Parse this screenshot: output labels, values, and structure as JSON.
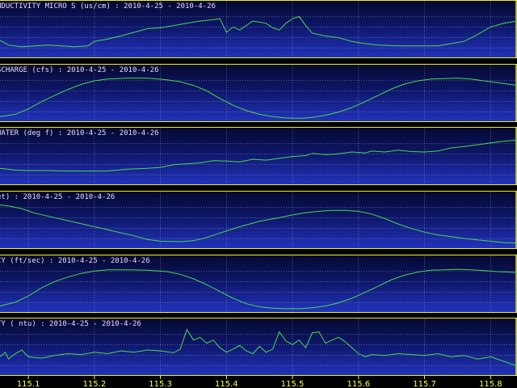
{
  "chart_data": {
    "type": "line",
    "x_ticks": [
      "115.1",
      "115.2",
      "115.3",
      "115.4",
      "115.5",
      "115.6",
      "115.7",
      "115.8"
    ],
    "xlim": [
      115.057,
      115.84
    ],
    "panels": [
      {
        "title": "NDUCTIVITY MICRO S (us/cm) : 2010-4-25 - 2010-4-26",
        "series_color": "#4cd84c",
        "points": [
          [
            115.057,
            0.32
          ],
          [
            115.07,
            0.22
          ],
          [
            115.09,
            0.18
          ],
          [
            115.11,
            0.2
          ],
          [
            115.13,
            0.22
          ],
          [
            115.15,
            0.2
          ],
          [
            115.17,
            0.18
          ],
          [
            115.19,
            0.2
          ],
          [
            115.2,
            0.3
          ],
          [
            115.22,
            0.35
          ],
          [
            115.24,
            0.42
          ],
          [
            115.26,
            0.5
          ],
          [
            115.28,
            0.58
          ],
          [
            115.3,
            0.6
          ],
          [
            115.32,
            0.65
          ],
          [
            115.34,
            0.7
          ],
          [
            115.36,
            0.75
          ],
          [
            115.38,
            0.78
          ],
          [
            115.39,
            0.8
          ],
          [
            115.4,
            0.5
          ],
          [
            115.41,
            0.62
          ],
          [
            115.42,
            0.55
          ],
          [
            115.44,
            0.75
          ],
          [
            115.46,
            0.7
          ],
          [
            115.47,
            0.6
          ],
          [
            115.48,
            0.55
          ],
          [
            115.49,
            0.7
          ],
          [
            115.5,
            0.8
          ],
          [
            115.51,
            0.85
          ],
          [
            115.52,
            0.65
          ],
          [
            115.53,
            0.48
          ],
          [
            115.55,
            0.42
          ],
          [
            115.57,
            0.38
          ],
          [
            115.59,
            0.3
          ],
          [
            115.61,
            0.25
          ],
          [
            115.63,
            0.22
          ],
          [
            115.66,
            0.2
          ],
          [
            115.69,
            0.2
          ],
          [
            115.72,
            0.2
          ],
          [
            115.74,
            0.25
          ],
          [
            115.76,
            0.3
          ],
          [
            115.78,
            0.45
          ],
          [
            115.8,
            0.62
          ],
          [
            115.82,
            0.7
          ],
          [
            115.84,
            0.75
          ]
        ]
      },
      {
        "title": "SCHARGE (cfs) : 2010-4-25 - 2010-4-26",
        "series_color": "#4cd84c",
        "points": [
          [
            115.057,
            0.05
          ],
          [
            115.08,
            0.1
          ],
          [
            115.1,
            0.22
          ],
          [
            115.12,
            0.38
          ],
          [
            115.14,
            0.52
          ],
          [
            115.16,
            0.65
          ],
          [
            115.18,
            0.76
          ],
          [
            115.2,
            0.84
          ],
          [
            115.22,
            0.88
          ],
          [
            115.25,
            0.9
          ],
          [
            115.28,
            0.9
          ],
          [
            115.31,
            0.86
          ],
          [
            115.33,
            0.82
          ],
          [
            115.35,
            0.74
          ],
          [
            115.37,
            0.62
          ],
          [
            115.39,
            0.45
          ],
          [
            115.41,
            0.3
          ],
          [
            115.43,
            0.18
          ],
          [
            115.45,
            0.1
          ],
          [
            115.47,
            0.05
          ],
          [
            115.49,
            0.02
          ],
          [
            115.51,
            0.01
          ],
          [
            115.53,
            0.03
          ],
          [
            115.55,
            0.08
          ],
          [
            115.57,
            0.15
          ],
          [
            115.59,
            0.25
          ],
          [
            115.61,
            0.38
          ],
          [
            115.63,
            0.52
          ],
          [
            115.65,
            0.66
          ],
          [
            115.67,
            0.77
          ],
          [
            115.69,
            0.84
          ],
          [
            115.71,
            0.88
          ],
          [
            115.73,
            0.89
          ],
          [
            115.75,
            0.9
          ],
          [
            115.77,
            0.88
          ],
          [
            115.79,
            0.84
          ],
          [
            115.81,
            0.8
          ],
          [
            115.84,
            0.74
          ]
        ]
      },
      {
        "title": "WATER (deg f) : 2010-4-25 - 2010-4-26",
        "series_color": "#4cd84c",
        "points": [
          [
            115.057,
            0.3
          ],
          [
            115.08,
            0.26
          ],
          [
            115.1,
            0.25
          ],
          [
            115.13,
            0.25
          ],
          [
            115.16,
            0.24
          ],
          [
            115.19,
            0.24
          ],
          [
            115.22,
            0.24
          ],
          [
            115.25,
            0.28
          ],
          [
            115.28,
            0.3
          ],
          [
            115.3,
            0.32
          ],
          [
            115.32,
            0.38
          ],
          [
            115.34,
            0.4
          ],
          [
            115.36,
            0.42
          ],
          [
            115.38,
            0.47
          ],
          [
            115.4,
            0.46
          ],
          [
            115.42,
            0.44
          ],
          [
            115.44,
            0.5
          ],
          [
            115.46,
            0.48
          ],
          [
            115.48,
            0.52
          ],
          [
            115.5,
            0.56
          ],
          [
            115.52,
            0.58
          ],
          [
            115.53,
            0.63
          ],
          [
            115.55,
            0.6
          ],
          [
            115.57,
            0.62
          ],
          [
            115.59,
            0.66
          ],
          [
            115.61,
            0.64
          ],
          [
            115.62,
            0.68
          ],
          [
            115.64,
            0.66
          ],
          [
            115.66,
            0.7
          ],
          [
            115.68,
            0.67
          ],
          [
            115.7,
            0.66
          ],
          [
            115.72,
            0.68
          ],
          [
            115.74,
            0.75
          ],
          [
            115.76,
            0.78
          ],
          [
            115.78,
            0.82
          ],
          [
            115.8,
            0.86
          ],
          [
            115.82,
            0.9
          ],
          [
            115.84,
            0.92
          ]
        ]
      },
      {
        "title": "et) : 2010-4-25 - 2010-4-26",
        "series_color": "#4cd84c",
        "points": [
          [
            115.057,
            0.9
          ],
          [
            115.07,
            0.88
          ],
          [
            115.09,
            0.82
          ],
          [
            115.11,
            0.72
          ],
          [
            115.14,
            0.62
          ],
          [
            115.17,
            0.52
          ],
          [
            115.2,
            0.42
          ],
          [
            115.23,
            0.32
          ],
          [
            115.26,
            0.22
          ],
          [
            115.28,
            0.14
          ],
          [
            115.3,
            0.1
          ],
          [
            115.33,
            0.09
          ],
          [
            115.35,
            0.11
          ],
          [
            115.37,
            0.18
          ],
          [
            115.39,
            0.28
          ],
          [
            115.42,
            0.42
          ],
          [
            115.45,
            0.54
          ],
          [
            115.48,
            0.62
          ],
          [
            115.5,
            0.68
          ],
          [
            115.52,
            0.73
          ],
          [
            115.54,
            0.76
          ],
          [
            115.56,
            0.78
          ],
          [
            115.58,
            0.78
          ],
          [
            115.6,
            0.76
          ],
          [
            115.62,
            0.7
          ],
          [
            115.64,
            0.6
          ],
          [
            115.66,
            0.48
          ],
          [
            115.68,
            0.38
          ],
          [
            115.7,
            0.3
          ],
          [
            115.72,
            0.24
          ],
          [
            115.74,
            0.2
          ],
          [
            115.76,
            0.16
          ],
          [
            115.78,
            0.13
          ],
          [
            115.8,
            0.1
          ],
          [
            115.82,
            0.07
          ],
          [
            115.84,
            0.06
          ]
        ]
      },
      {
        "title": "CY (ft/sec) : 2010-4-25 - 2010-4-26",
        "series_color": "#4cd84c",
        "points": [
          [
            115.057,
            0.08
          ],
          [
            115.08,
            0.16
          ],
          [
            115.1,
            0.3
          ],
          [
            115.12,
            0.48
          ],
          [
            115.14,
            0.62
          ],
          [
            115.16,
            0.72
          ],
          [
            115.18,
            0.8
          ],
          [
            115.2,
            0.85
          ],
          [
            115.22,
            0.88
          ],
          [
            115.25,
            0.88
          ],
          [
            115.28,
            0.87
          ],
          [
            115.31,
            0.84
          ],
          [
            115.33,
            0.78
          ],
          [
            115.35,
            0.68
          ],
          [
            115.37,
            0.55
          ],
          [
            115.39,
            0.4
          ],
          [
            115.41,
            0.25
          ],
          [
            115.43,
            0.13
          ],
          [
            115.45,
            0.06
          ],
          [
            115.47,
            0.03
          ],
          [
            115.49,
            0.02
          ],
          [
            115.51,
            0.02
          ],
          [
            115.53,
            0.04
          ],
          [
            115.55,
            0.08
          ],
          [
            115.57,
            0.15
          ],
          [
            115.59,
            0.25
          ],
          [
            115.61,
            0.38
          ],
          [
            115.63,
            0.52
          ],
          [
            115.65,
            0.66
          ],
          [
            115.67,
            0.76
          ],
          [
            115.69,
            0.83
          ],
          [
            115.71,
            0.87
          ],
          [
            115.73,
            0.88
          ],
          [
            115.75,
            0.89
          ],
          [
            115.77,
            0.88
          ],
          [
            115.79,
            0.86
          ],
          [
            115.81,
            0.84
          ],
          [
            115.84,
            0.82
          ]
        ]
      },
      {
        "title": "TY ( ntu) : 2010-4-25 - 2010-4-26",
        "series_color": "#4cd84c",
        "points": [
          [
            115.057,
            0.35
          ],
          [
            115.065,
            0.45
          ],
          [
            115.07,
            0.3
          ],
          [
            115.08,
            0.42
          ],
          [
            115.09,
            0.5
          ],
          [
            115.1,
            0.35
          ],
          [
            115.12,
            0.32
          ],
          [
            115.14,
            0.38
          ],
          [
            115.16,
            0.42
          ],
          [
            115.18,
            0.4
          ],
          [
            115.2,
            0.45
          ],
          [
            115.22,
            0.42
          ],
          [
            115.24,
            0.48
          ],
          [
            115.26,
            0.45
          ],
          [
            115.28,
            0.5
          ],
          [
            115.3,
            0.48
          ],
          [
            115.32,
            0.44
          ],
          [
            115.33,
            0.52
          ],
          [
            115.34,
            0.95
          ],
          [
            115.35,
            0.72
          ],
          [
            115.36,
            0.78
          ],
          [
            115.37,
            0.65
          ],
          [
            115.38,
            0.72
          ],
          [
            115.39,
            0.55
          ],
          [
            115.4,
            0.45
          ],
          [
            115.41,
            0.52
          ],
          [
            115.42,
            0.6
          ],
          [
            115.43,
            0.48
          ],
          [
            115.44,
            0.42
          ],
          [
            115.45,
            0.58
          ],
          [
            115.46,
            0.45
          ],
          [
            115.47,
            0.52
          ],
          [
            115.48,
            0.9
          ],
          [
            115.49,
            0.7
          ],
          [
            115.5,
            0.62
          ],
          [
            115.51,
            0.72
          ],
          [
            115.52,
            0.55
          ],
          [
            115.53,
            0.88
          ],
          [
            115.54,
            0.9
          ],
          [
            115.55,
            0.65
          ],
          [
            115.56,
            0.72
          ],
          [
            115.57,
            0.78
          ],
          [
            115.58,
            0.68
          ],
          [
            115.59,
            0.55
          ],
          [
            115.6,
            0.42
          ],
          [
            115.61,
            0.35
          ],
          [
            115.62,
            0.4
          ],
          [
            115.64,
            0.38
          ],
          [
            115.66,
            0.42
          ],
          [
            115.68,
            0.4
          ],
          [
            115.7,
            0.38
          ],
          [
            115.72,
            0.42
          ],
          [
            115.74,
            0.35
          ],
          [
            115.76,
            0.38
          ],
          [
            115.78,
            0.3
          ],
          [
            115.8,
            0.35
          ],
          [
            115.82,
            0.25
          ],
          [
            115.84,
            0.15
          ]
        ]
      }
    ]
  }
}
